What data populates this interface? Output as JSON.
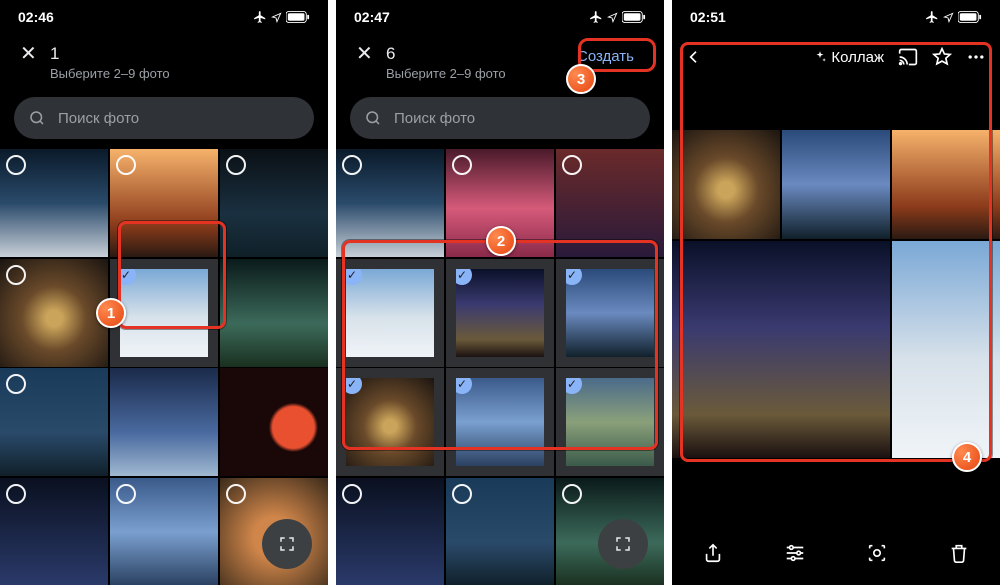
{
  "status": {
    "time1": "02:46",
    "time2": "02:47",
    "time3": "02:51"
  },
  "sel": {
    "count1": "1",
    "count6": "6",
    "sub": "Выберите 2–9 фото",
    "search_ph": "Поиск фото",
    "create": "Создать"
  },
  "viewer": {
    "title": "Коллаж"
  },
  "badges": {
    "b1": "1",
    "b2": "2",
    "b3": "3",
    "b4": "4"
  }
}
